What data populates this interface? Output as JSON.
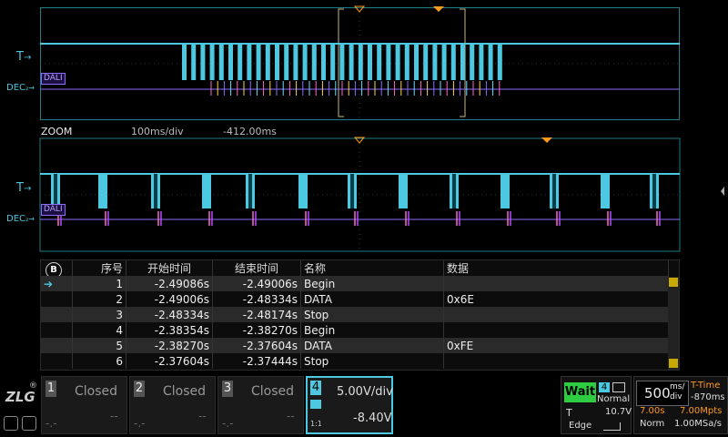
{
  "trigger_label": "T",
  "dec_label": "DEC",
  "dali_tag": "DALI",
  "zoom": {
    "title": "ZOOM",
    "timebase": "100ms/div",
    "offset": "-412.00ms"
  },
  "table": {
    "headers": [
      "序号",
      "开始时间",
      "结束时间",
      "名称",
      "数据"
    ],
    "rows": [
      {
        "idx": "1",
        "start": "-2.49086s",
        "end": "-2.49006s",
        "name": "Begin",
        "data": ""
      },
      {
        "idx": "2",
        "start": "-2.49006s",
        "end": "-2.48334s",
        "name": "DATA",
        "data": "0x6E"
      },
      {
        "idx": "3",
        "start": "-2.48334s",
        "end": "-2.48174s",
        "name": "Stop",
        "data": ""
      },
      {
        "idx": "4",
        "start": "-2.38354s",
        "end": "-2.38270s",
        "name": "Begin",
        "data": ""
      },
      {
        "idx": "5",
        "start": "-2.38270s",
        "end": "-2.37604s",
        "name": "DATA",
        "data": "0xFE"
      },
      {
        "idx": "6",
        "start": "-2.37604s",
        "end": "-2.37444s",
        "name": "Stop",
        "data": ""
      }
    ]
  },
  "channels": [
    {
      "num": "1",
      "state": "Closed",
      "a": "-.-",
      "b": "--"
    },
    {
      "num": "2",
      "state": "Closed",
      "a": "-.-",
      "b": "--"
    },
    {
      "num": "3",
      "state": "Closed",
      "a": "-.-",
      "b": "--"
    }
  ],
  "ch4": {
    "num": "4",
    "scale": "5.00V/div",
    "offset": "-8.40V",
    "ratio": "1:1"
  },
  "trigger": {
    "status": "Wait",
    "src_num": "4",
    "mode": "Normal",
    "label": "T",
    "level": "10.7V",
    "type": "Edge"
  },
  "timebase": {
    "value": "500",
    "unit_top": "ms/",
    "unit_bottom": "div",
    "time_mode": "T-Time",
    "time_offset": "-870ms",
    "record_time": "7.00s",
    "mpts": "7.00Mpts",
    "acq_mode": "Norm",
    "sample_rate": "1.00MSa/s"
  },
  "logo": "ZLG",
  "colors": {
    "cyan": "#4cc8e0",
    "orange": "#ff9a1a",
    "purple": "#8c6cff",
    "green_wait": "#2ecc40"
  }
}
